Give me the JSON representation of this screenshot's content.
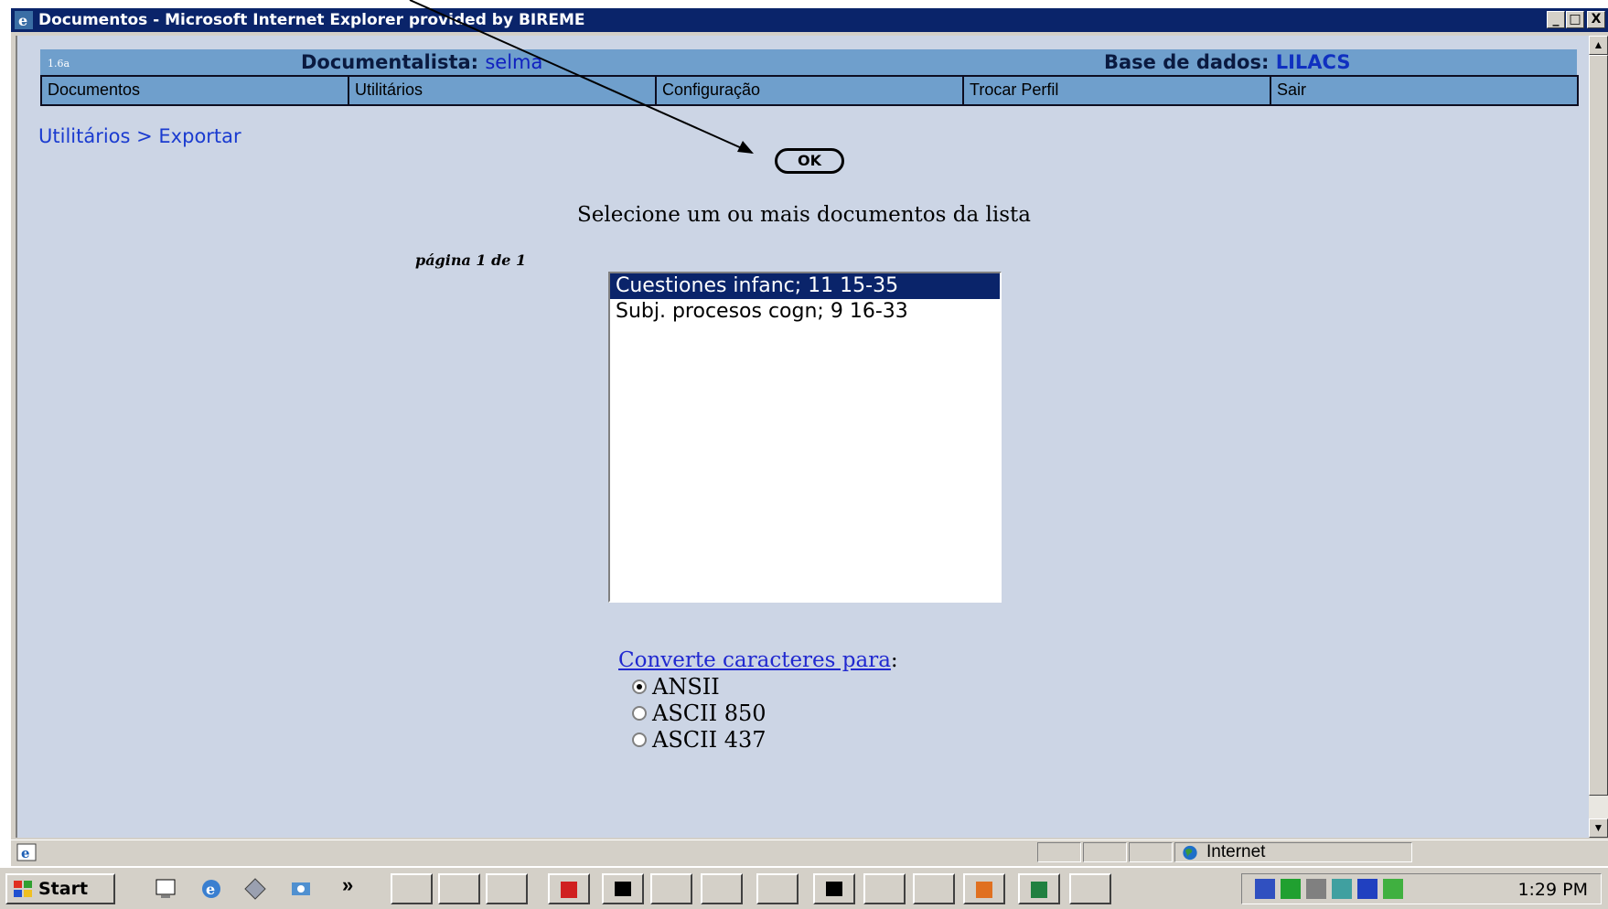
{
  "window": {
    "title": "Documentos - Microsoft Internet Explorer provided by BIREME",
    "minimize_glyph": "_",
    "maximize_glyph": "□",
    "close_glyph": "X"
  },
  "header": {
    "version": "1.6a",
    "documentalista_label": "Documentalista: ",
    "documentalista_value": "selma",
    "base_label": "Base de dados: ",
    "base_value": "LILACS"
  },
  "menu": {
    "items": [
      {
        "label": "Documentos"
      },
      {
        "label": "Utilitários"
      },
      {
        "label": "Configuração"
      },
      {
        "label": "Trocar Perfil"
      },
      {
        "label": "Sair"
      }
    ]
  },
  "breadcrumb": "Utilitários > Exportar",
  "ok_button": "OK",
  "instructions": "Selecione um ou mais documentos da lista",
  "pagination": "página 1 de 1",
  "documents": {
    "items": [
      {
        "label": "Cuestiones infanc; 11 15-35",
        "selected": true
      },
      {
        "label": "Subj. procesos cogn; 9 16-33",
        "selected": false
      }
    ]
  },
  "convert": {
    "link": "Converte caracteres para",
    "suffix": ":",
    "options": [
      {
        "label": "ANSII",
        "checked": true
      },
      {
        "label": "ASCII 850",
        "checked": false
      },
      {
        "label": "ASCII 437",
        "checked": false
      }
    ]
  },
  "statusbar": {
    "zone": "Internet"
  },
  "taskbar": {
    "start_label": "Start",
    "chevron": "»",
    "clock": "1:29 PM"
  },
  "colors": {
    "titlebar": "#0a246a",
    "header_blue": "#6f9fcc",
    "page_bg": "#ccd5e5",
    "link_blue": "#1a3bd0",
    "selection": "#0a246a"
  },
  "icons": {
    "title": "ie-icon",
    "status": "ie-page-icon",
    "zone": "globe-icon",
    "start": "windows-flag-icon"
  }
}
